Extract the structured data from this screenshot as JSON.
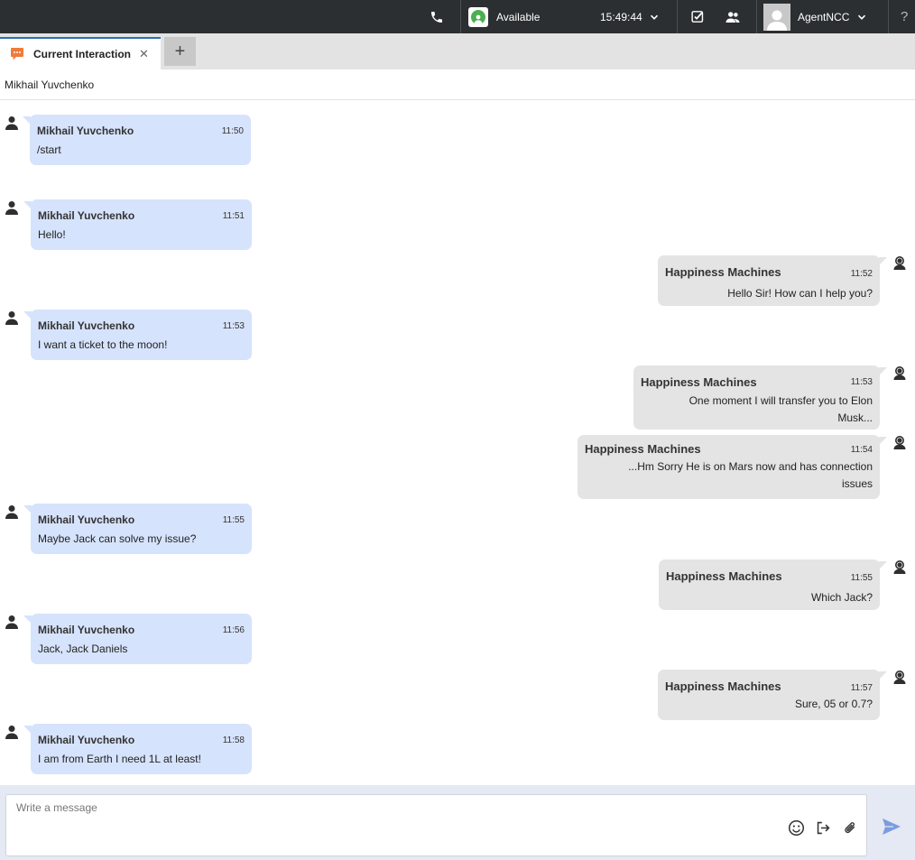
{
  "topbar": {
    "status_label": "Available",
    "clock": "15:49:44",
    "agent_name": "AgentNCC",
    "help_label": "?",
    "colors": {
      "background": "#2b2f31",
      "available": "#4caf50"
    }
  },
  "tabs": {
    "current_label": "Current Interaction",
    "close_label": "✕",
    "add_label": "+"
  },
  "contact": {
    "name": "Mikhail Yuvchenko"
  },
  "messages": [
    {
      "from": "customer",
      "sender": "Mikhail Yuvchenko",
      "time": "11:50",
      "lines": [
        "/start"
      ]
    },
    {
      "from": "customer",
      "sender": "Mikhail Yuvchenko",
      "time": "11:51",
      "lines": [
        "Hello!"
      ]
    },
    {
      "from": "bot",
      "sender": "Happiness Machines",
      "time": "11:52",
      "lines": [
        "Hello Sir! How can I help you?"
      ]
    },
    {
      "from": "customer",
      "sender": "Mikhail Yuvchenko",
      "time": "11:53",
      "lines": [
        "I want a ticket to the moon!"
      ]
    },
    {
      "from": "bot",
      "sender": "Happiness Machines",
      "time": "11:53",
      "lines": [
        "One moment I will transfer you to Elon",
        "Musk..."
      ]
    },
    {
      "from": "bot",
      "sender": "Happiness Machines",
      "time": "11:54",
      "lines": [
        "...Hm Sorry He is on Mars now and has connection",
        "issues"
      ]
    },
    {
      "from": "customer",
      "sender": "Mikhail Yuvchenko",
      "time": "11:55",
      "lines": [
        "Maybe Jack can solve my issue?"
      ]
    },
    {
      "from": "bot",
      "sender": "Happiness Machines",
      "time": "11:55",
      "lines": [
        "Which Jack?"
      ]
    },
    {
      "from": "customer",
      "sender": "Mikhail Yuvchenko",
      "time": "11:56",
      "lines": [
        "Jack, Jack Daniels"
      ]
    },
    {
      "from": "bot",
      "sender": "Happiness Machines",
      "time": "11:57",
      "lines": [
        "Sure, 05 or 0.7?"
      ]
    },
    {
      "from": "customer",
      "sender": "Mikhail Yuvchenko",
      "time": "11:58",
      "lines": [
        "I am from Earth I need 1L at least!"
      ]
    }
  ],
  "composer": {
    "placeholder": "Write a message",
    "icons": [
      "emoji-icon",
      "end-chat-icon",
      "attachment-icon",
      "send-icon"
    ]
  },
  "colors": {
    "customer_bubble": "#d6e3fc",
    "bot_bubble": "#e4e4e4",
    "tab_accent": "#2c6fb7",
    "send": "#7c9ce0"
  }
}
